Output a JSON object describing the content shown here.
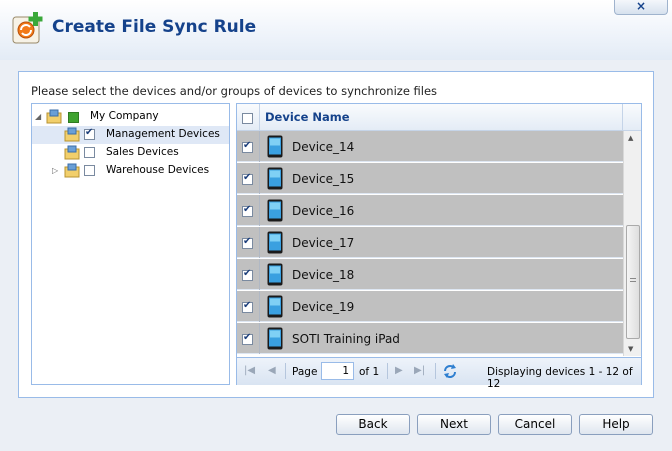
{
  "dialog": {
    "title": "Create File Sync Rule",
    "close_label": "×",
    "icon": "sync-add-icon"
  },
  "instruction": "Please select the devices and/or groups of devices to synchronize files",
  "tree": {
    "items": [
      {
        "label": "My Company",
        "checked": false,
        "indeterminate": true,
        "icon": "folder-icon"
      },
      {
        "label": "Management Devices",
        "checked": true,
        "selected": true,
        "icon": "folder-icon"
      },
      {
        "label": "Sales Devices",
        "checked": false,
        "icon": "folder-icon"
      },
      {
        "label": "Warehouse Devices",
        "checked": false,
        "expandable": true,
        "icon": "folder-icon"
      }
    ]
  },
  "grid": {
    "column_header": "Device Name",
    "rows": [
      {
        "name": "Device_14",
        "checked": true
      },
      {
        "name": "Device_15",
        "checked": true
      },
      {
        "name": "Device_16",
        "checked": true
      },
      {
        "name": "Device_17",
        "checked": true
      },
      {
        "name": "Device_18",
        "checked": true
      },
      {
        "name": "Device_19",
        "checked": true
      },
      {
        "name": "SOTI Training iPad",
        "checked": true
      }
    ],
    "row_icon": "tablet-icon"
  },
  "pager": {
    "page_label": "Page",
    "page_value": "1",
    "of_label": "of 1",
    "display_text": "Displaying devices 1 - 12 of 12"
  },
  "buttons": {
    "back": "Back",
    "next": "Next",
    "cancel": "Cancel",
    "help": "Help"
  },
  "colors": {
    "title": "#15428b",
    "border": "#99bbe8",
    "row_selected": "#c0c0c0"
  }
}
